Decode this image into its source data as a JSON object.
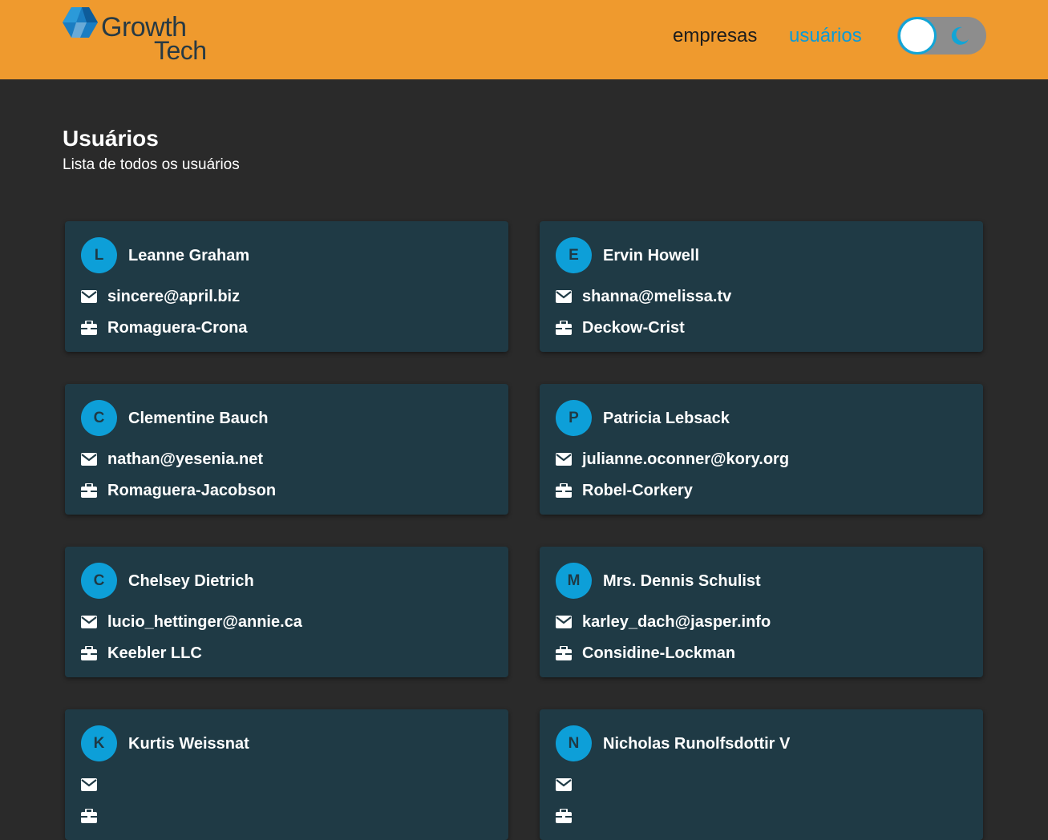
{
  "app": {
    "logo_line1": "Growth",
    "logo_line2": "Tech",
    "colors": {
      "header": "#ef9a2e",
      "accent": "#0b9ad6",
      "card": "#1f3a45",
      "background": "#2a2a2a"
    }
  },
  "nav": {
    "links": [
      {
        "label": "empresas",
        "active": false
      },
      {
        "label": "usuários",
        "active": true
      }
    ],
    "theme_toggle": {
      "icon": "moon-icon",
      "dark_mode": true
    }
  },
  "main": {
    "title": "Usuários",
    "subtitle": "Lista de todos os usuários",
    "users": [
      {
        "initial": "L",
        "name": "Leanne Graham",
        "email": "sincere@april.biz",
        "company": "Romaguera-Crona"
      },
      {
        "initial": "E",
        "name": "Ervin Howell",
        "email": "shanna@melissa.tv",
        "company": "Deckow-Crist"
      },
      {
        "initial": "C",
        "name": "Clementine Bauch",
        "email": "nathan@yesenia.net",
        "company": "Romaguera-Jacobson"
      },
      {
        "initial": "P",
        "name": "Patricia Lebsack",
        "email": "julianne.oconner@kory.org",
        "company": "Robel-Corkery"
      },
      {
        "initial": "C",
        "name": "Chelsey Dietrich",
        "email": "lucio_hettinger@annie.ca",
        "company": "Keebler LLC"
      },
      {
        "initial": "M",
        "name": "Mrs. Dennis Schulist",
        "email": "karley_dach@jasper.info",
        "company": "Considine-Lockman"
      },
      {
        "initial": "K",
        "name": "Kurtis Weissnat",
        "email": "",
        "company": ""
      },
      {
        "initial": "N",
        "name": "Nicholas Runolfsdottir V",
        "email": "",
        "company": ""
      }
    ]
  }
}
